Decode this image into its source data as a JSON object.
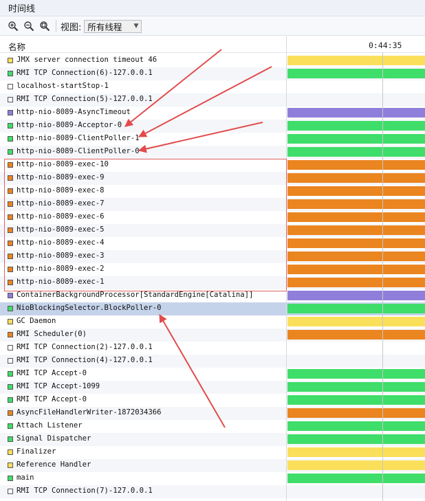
{
  "window": {
    "title": "时间线"
  },
  "toolbar": {
    "zoom_in_icon": "zoom-in-icon",
    "zoom_out_icon": "zoom-out-icon",
    "zoom_fit_icon": "zoom-fit-icon",
    "view_label": "视图:",
    "view_select_value": "所有线程"
  },
  "table": {
    "name_header": "名称",
    "time_header": "0:44:35"
  },
  "colors": {
    "running": "#3fdd6a",
    "sleeping": "#8f7fdb",
    "wait": "#fadf5b",
    "park": "#ea8520",
    "selected_row": "#c5d3ea",
    "annotation": "#e24b4b"
  },
  "threads": [
    {
      "name": "JMX server connection timeout 46",
      "state": "wait"
    },
    {
      "name": "RMI TCP Connection(6)-127.0.0.1",
      "state": "running"
    },
    {
      "name": "localhost-startStop-1",
      "state": "none"
    },
    {
      "name": "RMI TCP Connection(5)-127.0.0.1",
      "state": "none"
    },
    {
      "name": "http-nio-8089-AsyncTimeout",
      "state": "sleeping"
    },
    {
      "name": "http-nio-8089-Acceptor-0",
      "state": "running"
    },
    {
      "name": "http-nio-8089-ClientPoller-1",
      "state": "running"
    },
    {
      "name": "http-nio-8089-ClientPoller-0",
      "state": "running"
    },
    {
      "name": "http-nio-8089-exec-10",
      "state": "park"
    },
    {
      "name": "http-nio-8089-exec-9",
      "state": "park"
    },
    {
      "name": "http-nio-8089-exec-8",
      "state": "park"
    },
    {
      "name": "http-nio-8089-exec-7",
      "state": "park"
    },
    {
      "name": "http-nio-8089-exec-6",
      "state": "park"
    },
    {
      "name": "http-nio-8089-exec-5",
      "state": "park"
    },
    {
      "name": "http-nio-8089-exec-4",
      "state": "park"
    },
    {
      "name": "http-nio-8089-exec-3",
      "state": "park"
    },
    {
      "name": "http-nio-8089-exec-2",
      "state": "park"
    },
    {
      "name": "http-nio-8089-exec-1",
      "state": "park"
    },
    {
      "name": "ContainerBackgroundProcessor[StandardEngine[Catalina]]",
      "state": "sleeping"
    },
    {
      "name": "NioBlockingSelector.BlockPoller-0",
      "state": "running",
      "selected": true
    },
    {
      "name": "GC Daemon",
      "state": "wait"
    },
    {
      "name": "RMI Scheduler(0)",
      "state": "park"
    },
    {
      "name": "RMI TCP Connection(2)-127.0.0.1",
      "state": "none"
    },
    {
      "name": "RMI TCP Connection(4)-127.0.0.1",
      "state": "none"
    },
    {
      "name": "RMI TCP Accept-0",
      "state": "running"
    },
    {
      "name": "RMI TCP Accept-1099",
      "state": "running"
    },
    {
      "name": "RMI TCP Accept-0",
      "state": "running"
    },
    {
      "name": "AsyncFileHandlerWriter-1872034366",
      "state": "park"
    },
    {
      "name": "Attach Listener",
      "state": "running"
    },
    {
      "name": "Signal Dispatcher",
      "state": "running"
    },
    {
      "name": "Finalizer",
      "state": "wait"
    },
    {
      "name": "Reference Handler",
      "state": "wait"
    },
    {
      "name": "main",
      "state": "running"
    },
    {
      "name": "RMI TCP Connection(7)-127.0.0.1",
      "state": "none"
    }
  ]
}
